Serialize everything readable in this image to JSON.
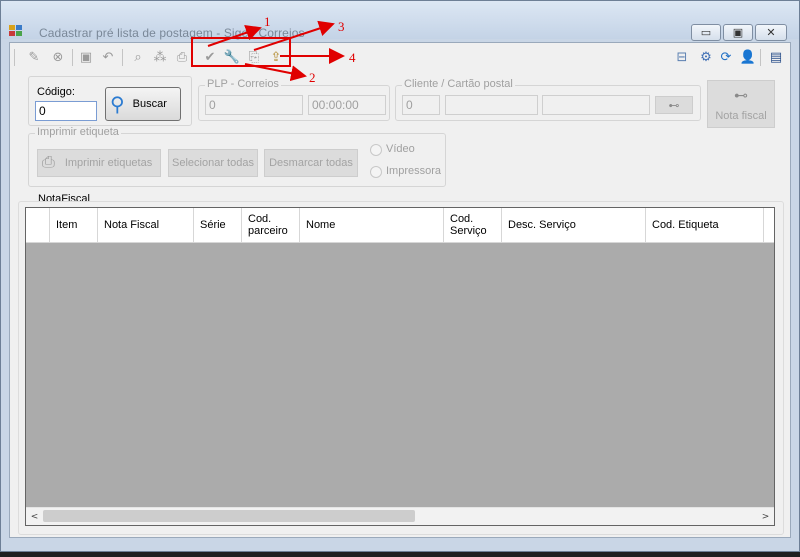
{
  "window": {
    "title": "Cadastrar pré lista de postagem - Sigep Correios",
    "minimize_glyph": "▭",
    "maximize_glyph": "▣",
    "close_glyph": "✕"
  },
  "toolbar": {
    "items": [
      "edit-icon",
      "cancel-icon",
      "save-icon",
      "undo-icon",
      "search-icon",
      "network-icon",
      "print-icon",
      "check-icon",
      "wrench-icon",
      "scanner-icon",
      "export-icon"
    ],
    "right_items": [
      "pc-icon",
      "settings-icon",
      "refresh-icon",
      "user-icon",
      "sidebar-icon"
    ]
  },
  "codigo": {
    "label": "Código:",
    "value": "0"
  },
  "buscar_label": "Buscar",
  "plp": {
    "group_title": "PLP - Correios",
    "number": "0",
    "time": "00:00:00"
  },
  "cliente": {
    "group_title": "Cliente / Cartão postal",
    "value": "0",
    "field2": "",
    "field3": ""
  },
  "nota_fiscal_button_label": "Nota fiscal",
  "imprimir": {
    "group_title": "Imprimir etiqueta",
    "print_label": "Imprimir etiquetas",
    "select_all_label": "Selecionar todas",
    "deselect_all_label": "Desmarcar todas",
    "radio_video": "Vídeo",
    "radio_impressora": "Impressora"
  },
  "grid": {
    "section_label": "NotaFiscal",
    "columns": [
      "Item",
      "Nota Fiscal",
      "Série",
      "Cod.\nparceiro",
      "Nome",
      "Cod.\nServiço",
      "Desc. Serviço",
      "Cod. Etiqueta"
    ],
    "left_arrow": "<",
    "right_arrow": ">"
  },
  "annotations": {
    "labels": [
      "1",
      "2",
      "3",
      "4"
    ],
    "color": "#e00000"
  }
}
